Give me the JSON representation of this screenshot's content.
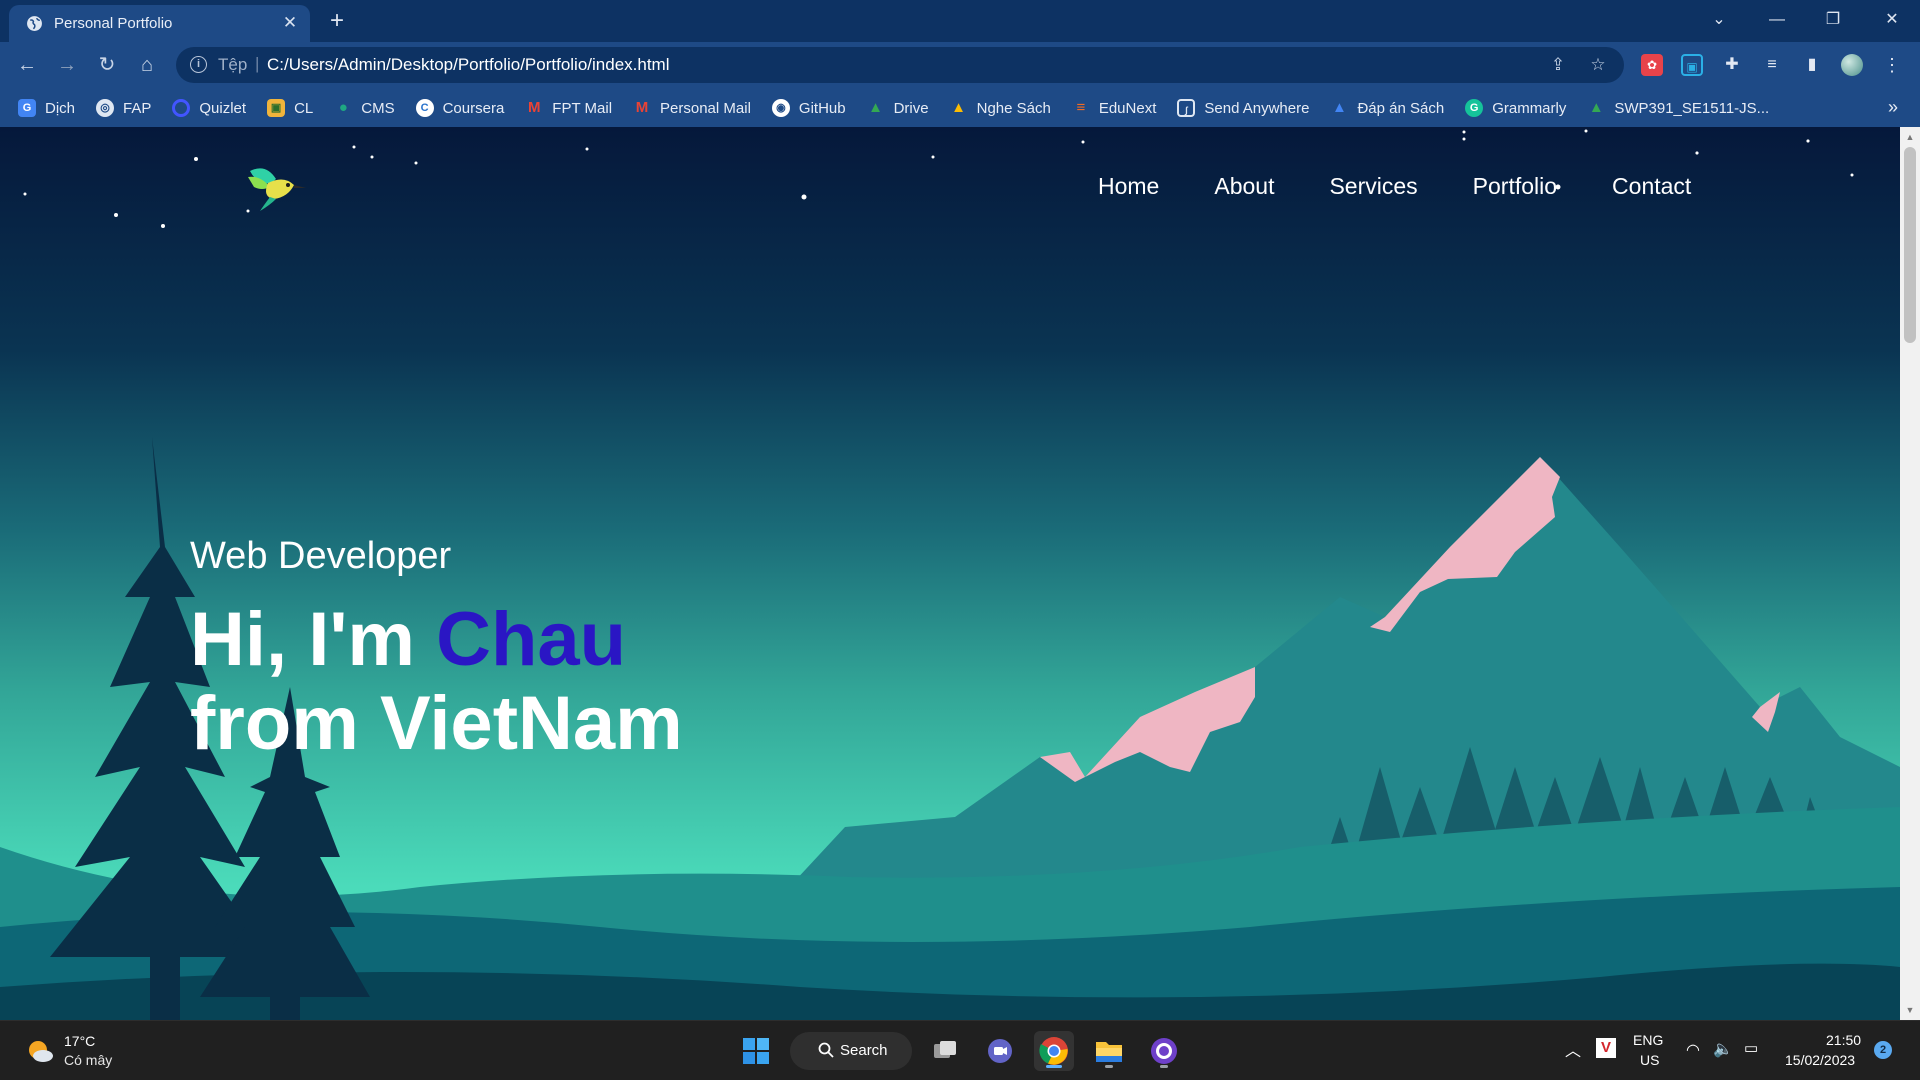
{
  "browser": {
    "tab": {
      "title": "Personal Portfolio"
    },
    "address": {
      "scheme_label": "Tệp",
      "url": "C:/Users/Admin/Desktop/Portfolio/Portfolio/index.html"
    },
    "bookmarks": [
      {
        "label": "Dịch",
        "icon": "translate-icon",
        "color": "#4285f4"
      },
      {
        "label": "FAP",
        "icon": "globe-icon",
        "color": "#cfd8e6"
      },
      {
        "label": "Quizlet",
        "icon": "quizlet-icon",
        "color": "#4255ff"
      },
      {
        "label": "CL",
        "icon": "cl-icon",
        "color": "#f0b43c"
      },
      {
        "label": "CMS",
        "icon": "cms-icon",
        "color": "#1fa882"
      },
      {
        "label": "Coursera",
        "icon": "coursera-icon",
        "color": "#2a73cc"
      },
      {
        "label": "FPT Mail",
        "icon": "gmail-icon",
        "color": "#ea4335"
      },
      {
        "label": "Personal Mail",
        "icon": "gmail-icon",
        "color": "#ea4335"
      },
      {
        "label": "GitHub",
        "icon": "github-icon",
        "color": "#ffffff"
      },
      {
        "label": "Drive",
        "icon": "drive-icon",
        "color": "#34a853"
      },
      {
        "label": "Nghe Sách",
        "icon": "drive-icon",
        "color": "#34a853"
      },
      {
        "label": "EduNext",
        "icon": "edunext-icon",
        "color": "#f26b21"
      },
      {
        "label": "Send Anywhere",
        "icon": "send-anywhere-icon",
        "color": "#1c4ea0"
      },
      {
        "label": "Đáp án Sách",
        "icon": "drive-icon",
        "color": "#34a853"
      },
      {
        "label": "Grammarly",
        "icon": "grammarly-icon",
        "color": "#15c39a"
      },
      {
        "label": "SWP391_SE1511-JS...",
        "icon": "drive-icon",
        "color": "#34a853"
      }
    ],
    "bookmarks_more": "»"
  },
  "page": {
    "nav": [
      "Home",
      "About",
      "Services",
      "Portfolio",
      "Contact"
    ],
    "hero": {
      "subtitle": "Web Developer",
      "line1_prefix": "Hi, I'm ",
      "name": "Chau",
      "line2": "from VietNam"
    },
    "colors": {
      "name_accent": "#2a16c4",
      "peak_pink": "#efb6c3"
    }
  },
  "taskbar": {
    "weather": {
      "temp": "17°C",
      "condition": "Có mây"
    },
    "search_label": "Search",
    "language": {
      "top": "ENG",
      "bottom": "US"
    },
    "clock": {
      "time": "21:50",
      "date": "15/02/2023"
    },
    "notifications": "2"
  }
}
